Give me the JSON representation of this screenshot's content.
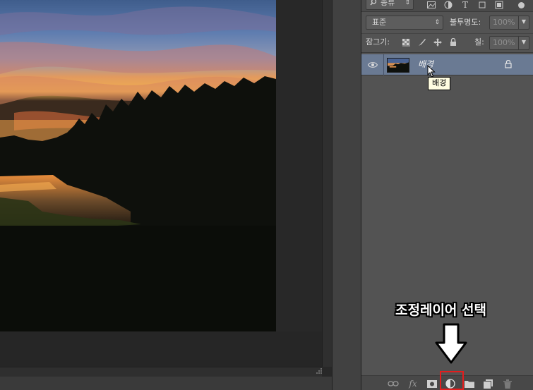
{
  "layers_panel": {
    "filter_kind": "종류",
    "blend_mode": "표준",
    "opacity_label": "불투명도:",
    "opacity_value": "100%",
    "lock_label": "잠그기:",
    "fill_label": "칠:",
    "fill_value": "100%",
    "layers": [
      {
        "name": "배경",
        "visible": true,
        "locked": true,
        "selected": true
      }
    ],
    "tooltip": "배경"
  },
  "annotation": {
    "text": "조정레이어 선택",
    "highlight_color": "#e31d1d"
  },
  "footer": {
    "fx_label": "fx"
  },
  "colors": {
    "panel_bg": "#535353",
    "selected_layer": "#6a7a93",
    "canvas_bg": "#282828"
  }
}
